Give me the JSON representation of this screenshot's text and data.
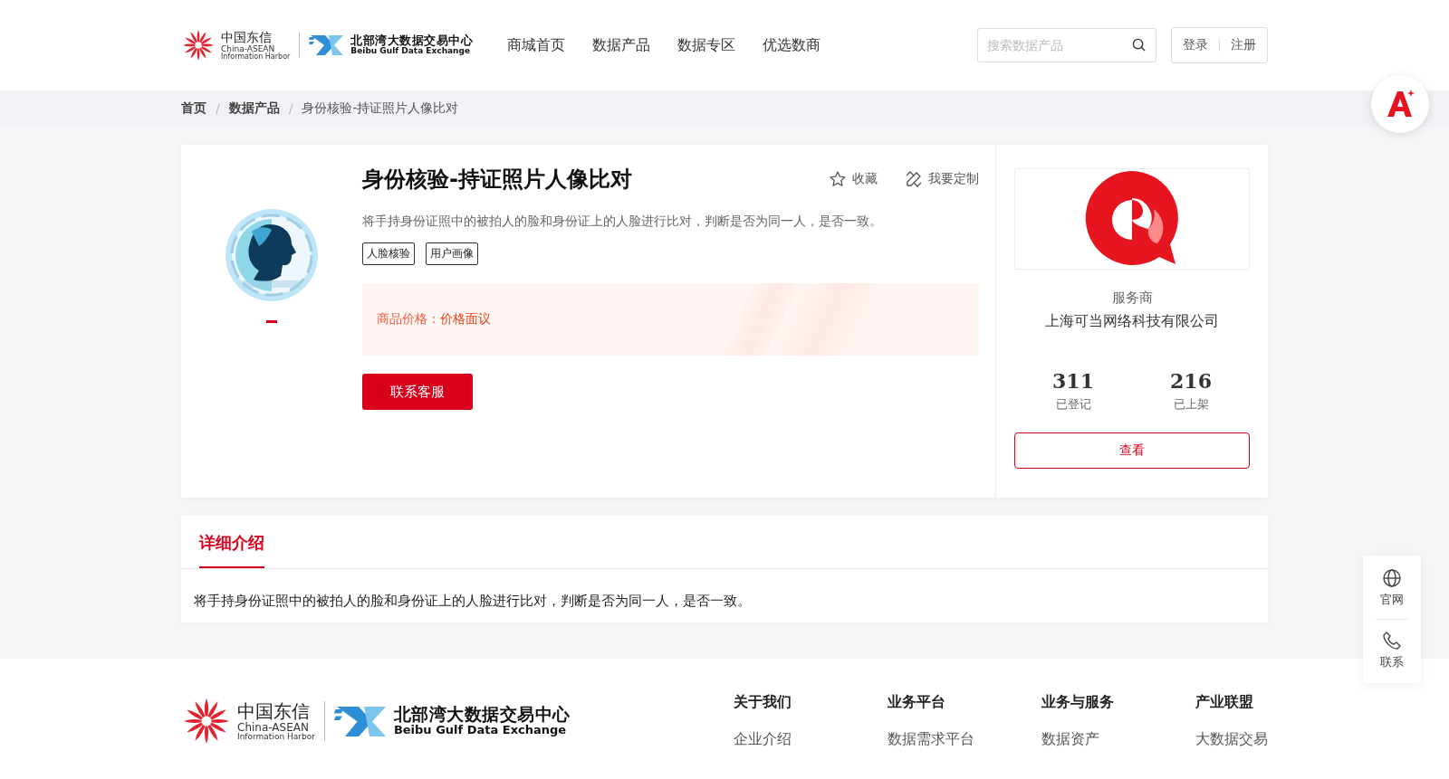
{
  "header": {
    "logo": {
      "cn_name": "中国东信",
      "en_name": "China-ASEAN",
      "en_sub": "Information Harbor",
      "exchange_cn": "北部湾大数据交易中心",
      "exchange_en": "Beibu Gulf Data Exchange"
    },
    "nav": [
      "商城首页",
      "数据产品",
      "数据专区",
      "优选数商"
    ],
    "search": {
      "placeholder": "搜索数据产品"
    },
    "auth": [
      "登录",
      "注册"
    ]
  },
  "breadcrumb": [
    {
      "label": "首页",
      "current": false
    },
    {
      "separator": "/",
      "label": "数据产品",
      "current": false
    },
    {
      "separator": "/",
      "label": "身份核验-持证照片人像比对",
      "current": true
    }
  ],
  "product": {
    "title": "身份核验-持证照片人像比对",
    "description": "将手持身份证照中的被拍人的脸和身份证上的人脸进行比对，判断是否为同一人，是否一致。",
    "tags": [
      "人脸核验",
      "用户画像"
    ],
    "actions": [
      {
        "kind": "favorite",
        "label": "收藏"
      },
      {
        "kind": "customize",
        "label": "我要定制"
      }
    ],
    "price_label": "商品价格：",
    "price_value": "价格面议",
    "contact_button": "联系客服"
  },
  "provider": {
    "role": "服务商",
    "name": "上海可当网络科技有限公司",
    "stats": [
      {
        "value": "311",
        "label": "已登记"
      },
      {
        "value": "216",
        "label": "已上架"
      }
    ],
    "view_button": "查看"
  },
  "detail": {
    "tabs": [
      {
        "label": "详细介绍",
        "selected": true
      }
    ],
    "text": "将手持身份证照中的被拍人的脸和身份证上的人脸进行比对，判断是否为同一人，是否一致。"
  },
  "side_widget": [
    {
      "kind": "globe",
      "label": "官网"
    },
    {
      "kind": "phone",
      "label": "联系"
    }
  ],
  "footer": {
    "logo": {
      "cn_name": "中国东信",
      "en_name": "China-ASEAN",
      "en_sub": "Information Harbor",
      "exchange_cn": "北部湾大数据交易中心",
      "exchange_en": "Beibu Gulf Data Exchange"
    },
    "columns": [
      {
        "title": "关于我们",
        "links": [
          "企业介绍"
        ]
      },
      {
        "title": "业务平台",
        "links": [
          "数据需求平台"
        ]
      },
      {
        "title": "业务与服务",
        "links": [
          "数据资产"
        ]
      },
      {
        "title": "产业联盟",
        "links": [
          "大数据交易"
        ]
      }
    ]
  }
}
